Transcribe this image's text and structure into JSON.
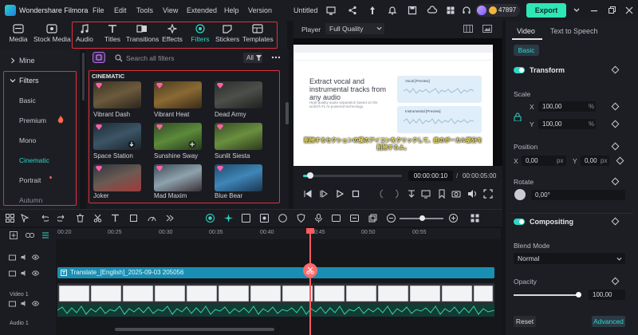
{
  "titlebar": {
    "app_name": "Wondershare Filmora",
    "menu": [
      "File",
      "Edit",
      "Tools",
      "View",
      "Extended",
      "Help",
      "Version"
    ],
    "project": "Untitled",
    "credits": "47897",
    "export_label": "Export"
  },
  "media_toolbar": {
    "tools": [
      {
        "label": "Media",
        "icon": "media-icon"
      },
      {
        "label": "Stock Media",
        "icon": "stock-media-icon"
      },
      {
        "label": "Audio",
        "icon": "audio-icon"
      },
      {
        "label": "Titles",
        "icon": "titles-icon"
      },
      {
        "label": "Transitions",
        "icon": "transitions-icon"
      },
      {
        "label": "Effects",
        "icon": "effects-icon"
      },
      {
        "label": "Filters",
        "icon": "filters-icon",
        "active": true
      },
      {
        "label": "Stickers",
        "icon": "stickers-icon"
      },
      {
        "label": "Templates",
        "icon": "templates-icon"
      }
    ]
  },
  "sidebar": {
    "mine": "Mine",
    "filters": "Filters",
    "categories": [
      "Basic",
      "Premium",
      "Mono",
      "Cinematic",
      "Portrait",
      "Autumn"
    ],
    "active_category": "Cinematic"
  },
  "filter_grid": {
    "search_placeholder": "Search all filters",
    "all_label": "All",
    "section": "CINEMATIC",
    "items": [
      "Vibrant Dash",
      "Vibrant Heat",
      "Dead Army",
      "Space Station",
      "Sunshine Sway",
      "Sunlit Siesta",
      "Joker",
      "Mad Maxim",
      "Blue Bear"
    ]
  },
  "player": {
    "label": "Player",
    "quality": "Full Quality",
    "headline": "Extract vocal and instrumental tracks from any audio",
    "subline": "High-quality audio separation based on the world's #1 AI-powered technology.",
    "card_vocal": "Vocal [Preview]",
    "card_instrumental": "Instrumental [Preview]",
    "subtitle": "削除するセクションの横のアイコンをクリックして、曲のボーカル部分を削除するよ。",
    "time_current": "00:00:00:10",
    "time_separator": "/",
    "time_total": "00:00:05:00",
    "progress": 0.07
  },
  "properties": {
    "tab_video": "Video",
    "tab_tts": "Text to Speech",
    "basic": "Basic",
    "transform": "Transform",
    "scale": "Scale",
    "scale_x_label": "X",
    "scale_x": "100,00",
    "scale_y_label": "Y",
    "scale_y": "100,00",
    "scale_unit": "%",
    "position": "Position",
    "pos_x_label": "X",
    "pos_x": "0,00",
    "pos_y_label": "Y",
    "pos_y": "0,00",
    "pos_unit": "px",
    "rotate": "Rotate",
    "rotate_val": "0,00°",
    "compositing": "Compositing",
    "blend_mode": "Blend Mode",
    "blend_value": "Normal",
    "opacity": "Opacity",
    "opacity_val": "100,00",
    "reset": "Reset",
    "advanced": "Advanced"
  },
  "timeline": {
    "ticks": [
      "00:20",
      "00:25",
      "00:30",
      "00:35",
      "00:40",
      "00:45",
      "00:50",
      "00:55"
    ],
    "title_clip": "Translate_[English]_2025-09-03 205056",
    "track_video": "Video 1",
    "track_audio": "Audio 1"
  },
  "colors": {
    "accent": "#2fd7c6",
    "highlight_box": "#e02f3c",
    "playhead": "#ff5a5f"
  }
}
